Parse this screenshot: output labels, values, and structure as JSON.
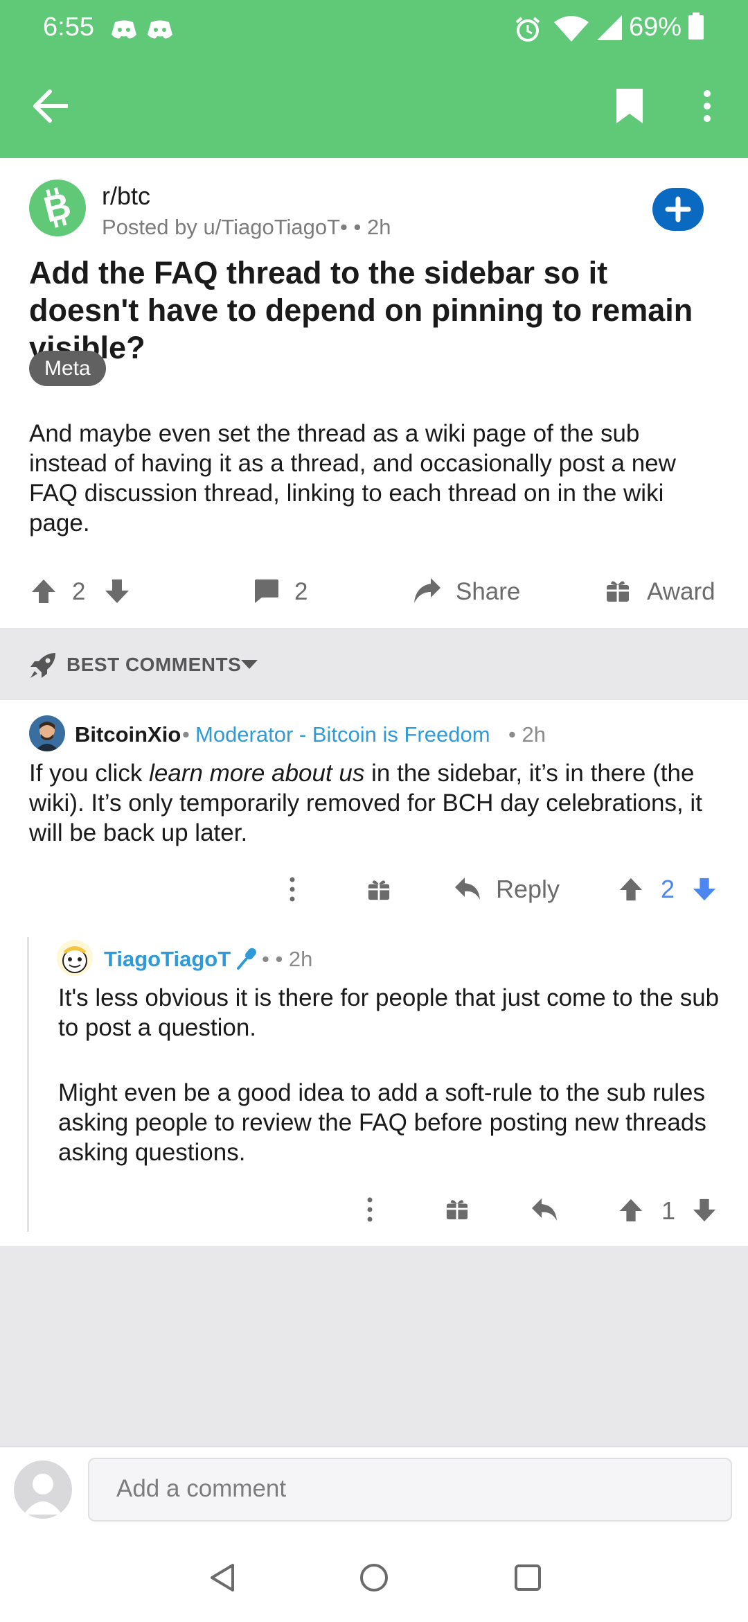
{
  "status_bar": {
    "time": "6:55",
    "battery": "69%",
    "icons": [
      "discord-icon",
      "discord-icon",
      "alarm-icon",
      "wifi-icon",
      "signal-icon",
      "battery-icon"
    ]
  },
  "app_bar": {
    "icons": [
      "back-arrow-icon",
      "bookmark-icon",
      "more-vertical-icon"
    ],
    "color": "#5fc977"
  },
  "post": {
    "subreddit": "r/btc",
    "posted_by": "Posted by u/TiagoTiagoT•  • 2h",
    "title": "Add the FAQ thread to the sidebar so it doesn't have to depend on pinning to remain visible?",
    "flair": "Meta",
    "body": "And maybe even set the thread as a wiki page of the sub instead of having it as a thread, and occasionally post a new FAQ discussion thread, linking to each thread on in the wiki page.",
    "votes": "2",
    "comments": "2",
    "share_label": "Share",
    "award_label": "Award"
  },
  "sort": {
    "label": "BEST COMMENTS"
  },
  "comments": [
    {
      "author": "BitcoinXio",
      "separator": "•",
      "flair": "Moderator - Bitcoin is Freedom",
      "time": "• 2h",
      "body_before": "If you click ",
      "body_italic": "learn more about us",
      "body_after": " in the sidebar, it’s in there (the wiki). It’s only temporarily removed for BCH day celebrations, it will be back up later.",
      "reply_label": "Reply",
      "votes": "2"
    },
    {
      "author": "TiagoTiagoT",
      "meta": "•  • 2h",
      "paragraph1": "It's less obvious it is there for people that just come to the sub to post a question.",
      "paragraph2": "Might even be a good idea to add a soft-rule to the sub rules asking people to review the FAQ before posting new threads asking questions.",
      "votes": "1"
    }
  ],
  "comment_bar": {
    "placeholder": "Add a comment"
  },
  "colors": {
    "accent_green": "#5fc977",
    "moderator_blue": "#2f9ad8",
    "downvote_blue": "#4c86f0",
    "join_blue": "#0a6ac2"
  }
}
